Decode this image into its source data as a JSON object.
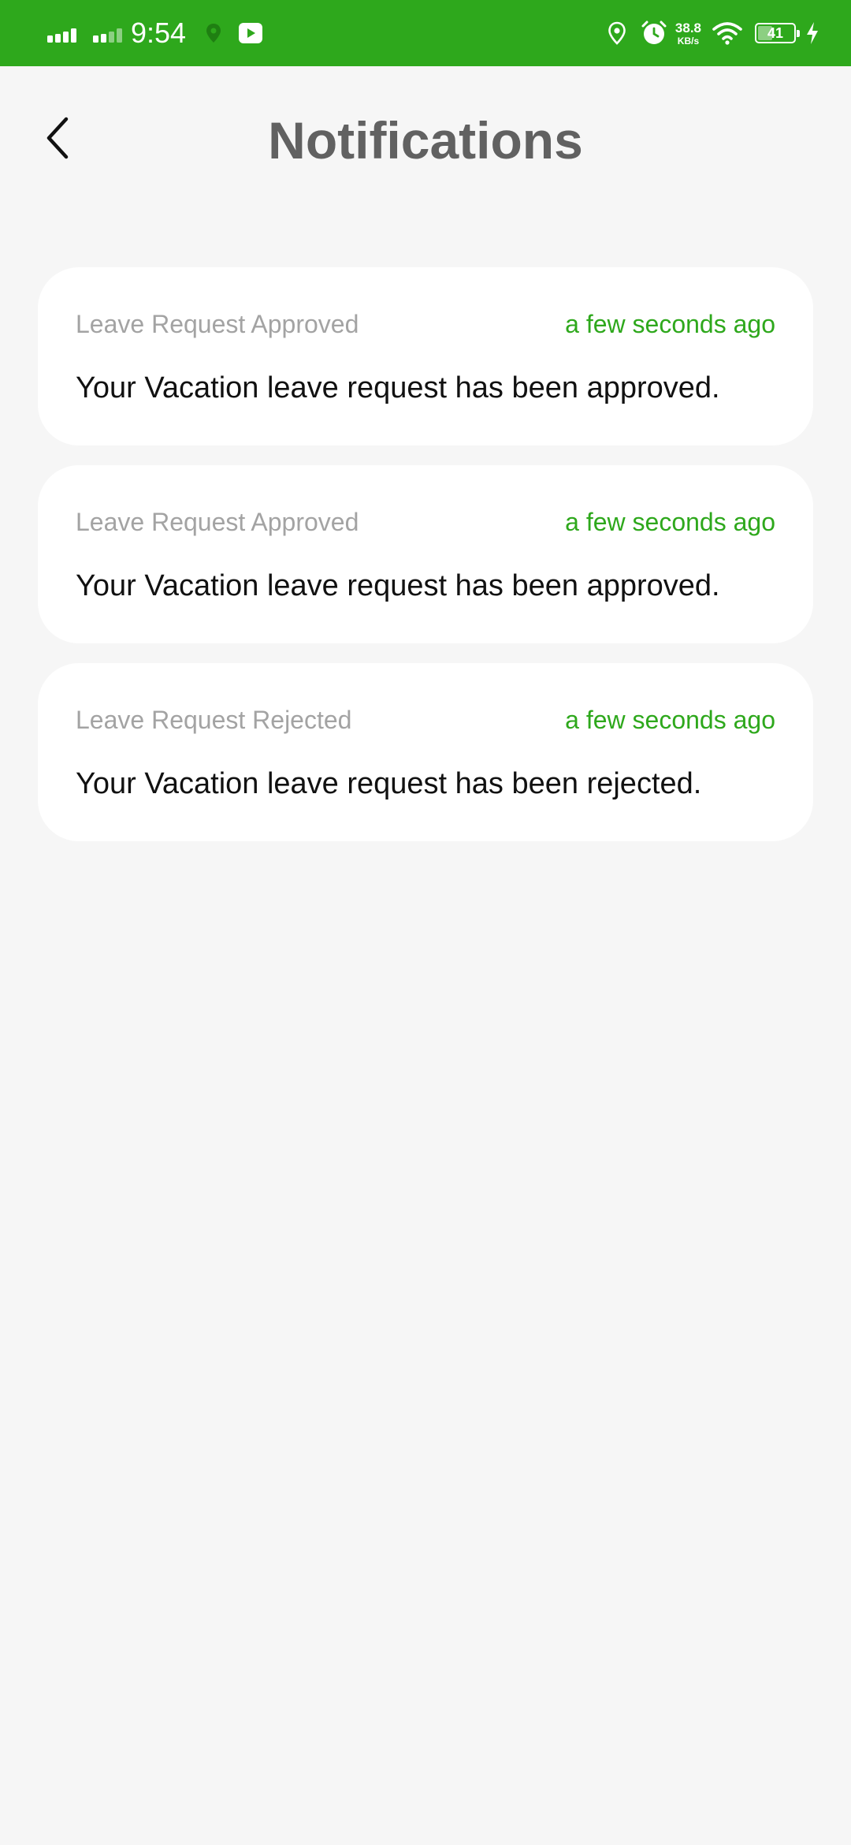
{
  "status_bar": {
    "time": "9:54",
    "speed_value": "38.8",
    "speed_unit": "KB/s",
    "battery_level": "41",
    "battery_fraction": 0.41,
    "background_color": "#2ea81c",
    "icons": [
      "signal-icon",
      "signal-icon",
      "location-icon",
      "youtube-icon",
      "location-icon",
      "alarm-icon",
      "wifi-icon",
      "battery-icon",
      "charging-icon"
    ]
  },
  "header": {
    "title": "Notifications",
    "back_icon": "chevron-left-icon"
  },
  "colors": {
    "accent": "#2ea81c",
    "title": "#616161",
    "subtle": "#a3a3a3",
    "background": "#f6f6f6"
  },
  "notifications": [
    {
      "title": "Leave Request Approved",
      "time": "a few seconds ago",
      "message": "Your Vacation leave request has been approved."
    },
    {
      "title": "Leave Request Approved",
      "time": "a few seconds ago",
      "message": "Your Vacation leave request has been approved."
    },
    {
      "title": "Leave Request Rejected",
      "time": "a few seconds ago",
      "message": "Your Vacation leave request has been rejected."
    }
  ]
}
